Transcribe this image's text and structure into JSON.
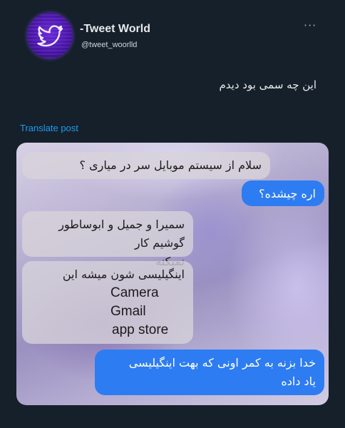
{
  "header": {
    "display_name": "-Tweet World",
    "handle": "@tweet_woorlld",
    "more_label": "···"
  },
  "post": {
    "text": "این چه سمی بود دیدم",
    "translate_label": "Translate post"
  },
  "chat": {
    "m1": "سلام از سیستم موبایل سر در میاری ؟",
    "m2": "اره چیشده؟",
    "m3_line1": "سمیرا و جمیل و ابوساطور گوشیم کار",
    "m3_line2": "نمیکنه",
    "m4_line1": "اینگیلیسی شون میشه این",
    "m4_line2": "Camera",
    "m4_line3": "Gmail",
    "m4_line4": "app store",
    "m5_line1": "خدا بزنه به کمر اونی که بهت اینگیلیسی",
    "m5_line2": "یاد داده"
  },
  "colors": {
    "background": "#15202b",
    "link": "#1d9bf0",
    "outgoing_bubble": "#2e7cf2"
  },
  "icons": {
    "avatar": "bird-icon",
    "more": "more-icon"
  }
}
